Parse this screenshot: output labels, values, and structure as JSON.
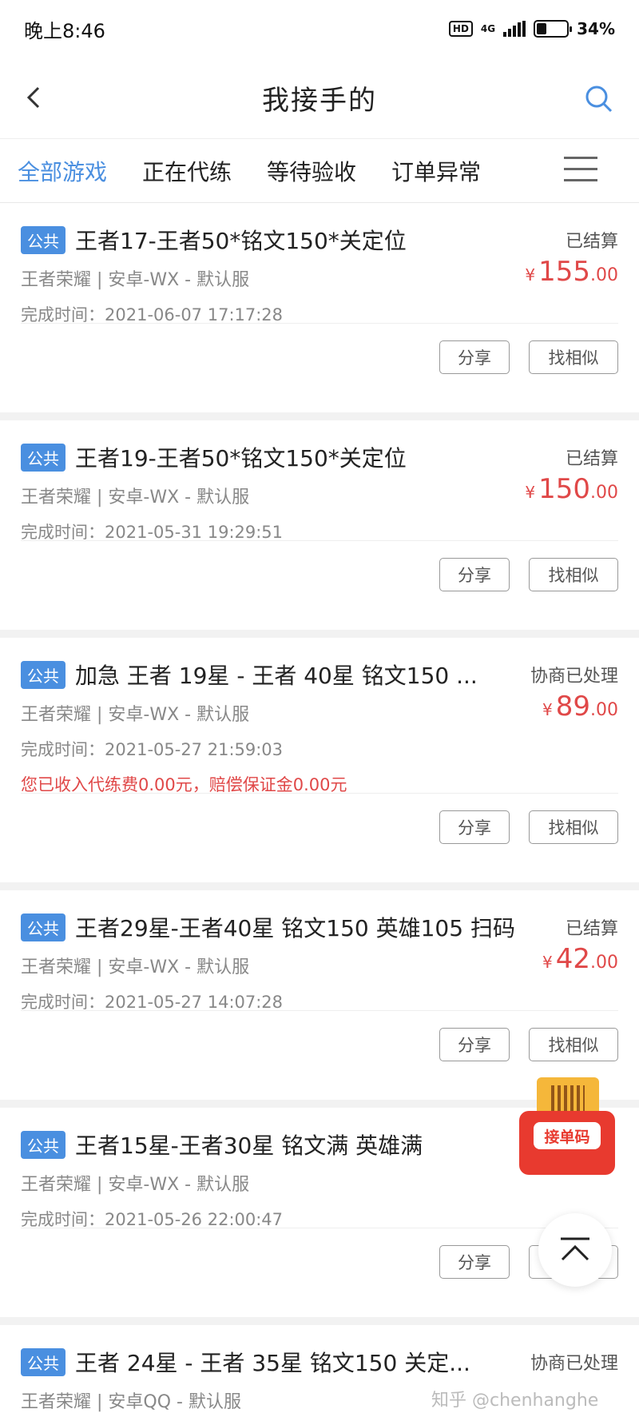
{
  "status_bar": {
    "time": "晚上8:46",
    "hd": "HD",
    "network": "4G",
    "battery": "34%",
    "battery_level": 0.34
  },
  "nav": {
    "title": "我接手的",
    "back_icon": "chevron-left-icon",
    "search_icon": "search-icon"
  },
  "tabs": [
    {
      "label": "全部游戏",
      "active": true
    },
    {
      "label": "正在代练",
      "active": false
    },
    {
      "label": "等待验收",
      "active": false
    },
    {
      "label": "订单异常",
      "active": false
    }
  ],
  "orders": [
    {
      "tag": "公共",
      "title": "王者17-王者50*铭文150*关定位",
      "status": "已结算",
      "currency": "¥",
      "price_int": "155",
      "price_dec": ".00",
      "game": "王者荣耀 | 安卓-WX - 默认服",
      "time": "完成时间：2021-06-07 17:17:28",
      "note": "",
      "share": "分享",
      "similar": "找相似"
    },
    {
      "tag": "公共",
      "title": "王者19-王者50*铭文150*关定位",
      "status": "已结算",
      "currency": "¥",
      "price_int": "150",
      "price_dec": ".00",
      "game": "王者荣耀 | 安卓-WX - 默认服",
      "time": "完成时间：2021-05-31 19:29:51",
      "note": "",
      "share": "分享",
      "similar": "找相似"
    },
    {
      "tag": "公共",
      "title": "加急 王者 19星 - 王者 40星 铭文150 ...",
      "status": "协商已处理",
      "currency": "¥",
      "price_int": "89",
      "price_dec": ".00",
      "game": "王者荣耀 | 安卓-WX - 默认服",
      "time": "完成时间：2021-05-27 21:59:03",
      "note": "您已收入代练费0.00元，赔偿保证金0.00元",
      "share": "分享",
      "similar": "找相似"
    },
    {
      "tag": "公共",
      "title": "王者29星-王者40星 铭文150 英雄105 扫码",
      "status": "已结算",
      "currency": "¥",
      "price_int": "42",
      "price_dec": ".00",
      "game": "王者荣耀 | 安卓-WX - 默认服",
      "time": "完成时间：2021-05-27 14:07:28",
      "note": "",
      "share": "分享",
      "similar": "找相似"
    },
    {
      "tag": "公共",
      "title": "王者15星-王者30星 铭文满 英雄满",
      "status": "",
      "currency": "",
      "price_int": "",
      "price_dec": "",
      "game": "王者荣耀 | 安卓-WX - 默认服",
      "time": "完成时间：2021-05-26 22:00:47",
      "note": "",
      "share": "分享",
      "similar": "找相似"
    },
    {
      "tag": "公共",
      "title": "王者 24星 - 王者 35星 铭文150 关定...",
      "status": "协商已处理",
      "currency": "",
      "price_int": "",
      "price_dec": "",
      "game": "王者荣耀 | 安卓QQ - 默认服",
      "time": "",
      "note": "",
      "share": "",
      "similar": ""
    }
  ],
  "floating": {
    "qr_label": "接单码",
    "qr_icon": "qr-ticket-icon",
    "top_icon": "back-to-top-icon"
  },
  "watermark": "知乎 @chenhanghe"
}
